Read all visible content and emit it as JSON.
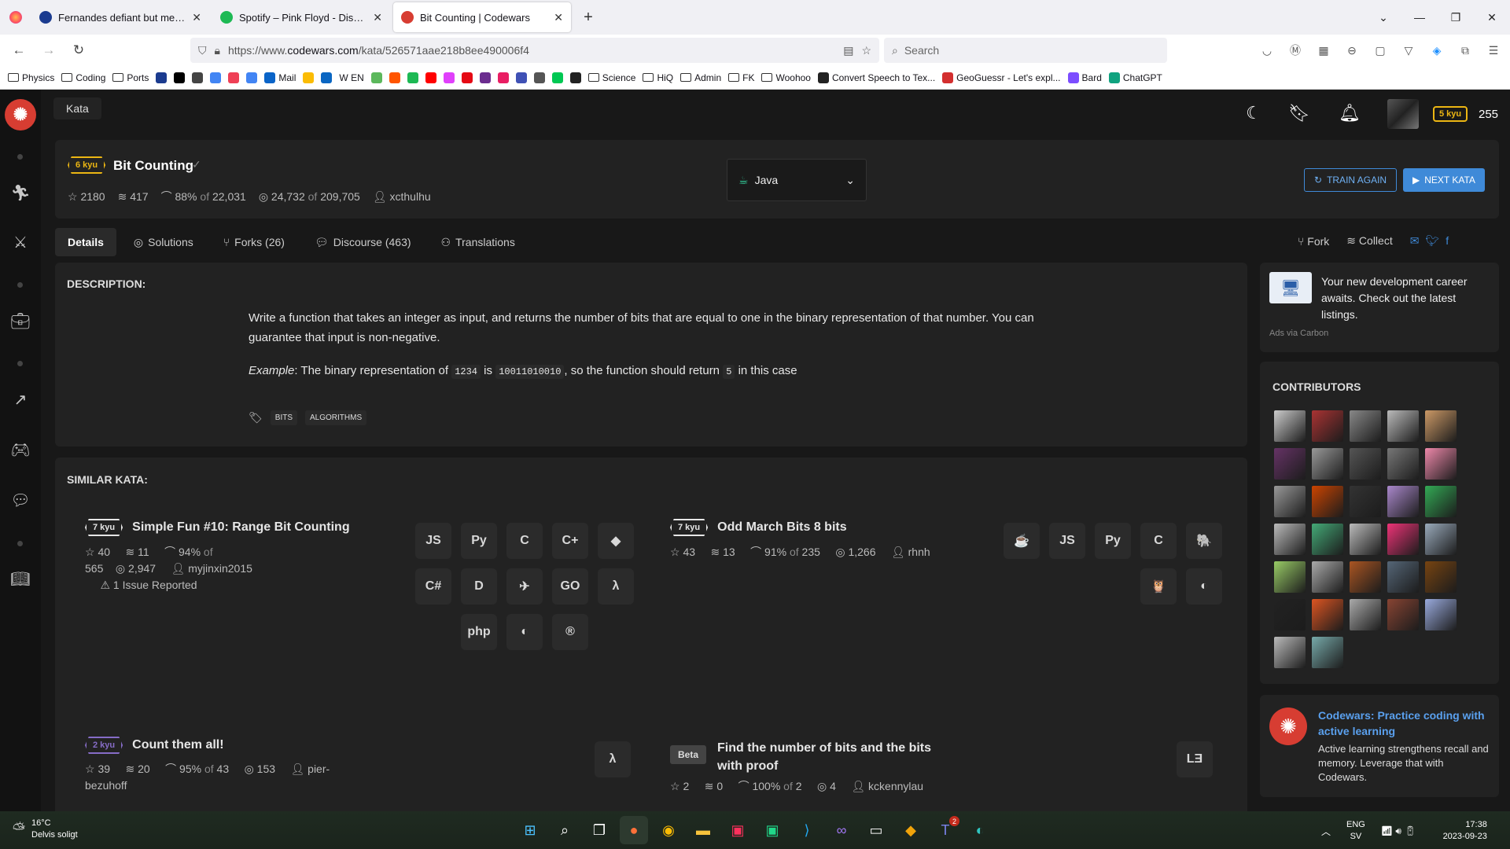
{
  "browser": {
    "tabs": [
      {
        "title": "Fernandes defiant but mess in M",
        "icon": "facebook-icon",
        "color": "#1b3b8f"
      },
      {
        "title": "Spotify – Pink Floyd - Discograp",
        "icon": "spotify-icon",
        "color": "#1db954"
      },
      {
        "title": "Bit Counting | Codewars",
        "icon": "codewars-icon",
        "color": "#d73d32"
      }
    ],
    "url_prefix": "https://www.",
    "url_host": "codewars.com",
    "url_path": "/kata/526571aae218b8ee490006f4",
    "search_placeholder": "Search",
    "bookmarks": [
      {
        "label": "Physics",
        "type": "folder"
      },
      {
        "label": "Coding",
        "type": "folder"
      },
      {
        "label": "Ports",
        "type": "folder"
      },
      {
        "label": "",
        "type": "icon",
        "color": "#1b3b8f"
      },
      {
        "label": "",
        "type": "icon",
        "color": "#000"
      },
      {
        "label": "",
        "type": "icon",
        "color": "#444"
      },
      {
        "label": "",
        "type": "icon",
        "color": "#4285f4"
      },
      {
        "label": "",
        "type": "icon",
        "color": "#ef4056"
      },
      {
        "label": "",
        "type": "icon",
        "color": "#4285f4"
      },
      {
        "label": "Mail",
        "type": "icon",
        "color": "#0a64c8"
      },
      {
        "label": "",
        "type": "icon",
        "color": "#fbbc04"
      },
      {
        "label": "",
        "type": "icon",
        "color": "#0a66c2"
      },
      {
        "label": "W EN",
        "type": "text"
      },
      {
        "label": "",
        "type": "icon",
        "color": "#5cb85c"
      },
      {
        "label": "",
        "type": "icon",
        "color": "#ff5500"
      },
      {
        "label": "",
        "type": "icon",
        "color": "#1db954"
      },
      {
        "label": "",
        "type": "icon",
        "color": "#ff0000"
      },
      {
        "label": "",
        "type": "icon",
        "color": "#e040fb"
      },
      {
        "label": "",
        "type": "icon",
        "color": "#e50914"
      },
      {
        "label": "",
        "type": "icon",
        "color": "#6b2d8f"
      },
      {
        "label": "",
        "type": "icon",
        "color": "#e91e63"
      },
      {
        "label": "",
        "type": "icon",
        "color": "#3f51b5"
      },
      {
        "label": "",
        "type": "icon",
        "color": "#555"
      },
      {
        "label": "",
        "type": "icon",
        "color": "#00c853"
      },
      {
        "label": "",
        "type": "icon",
        "color": "#222"
      },
      {
        "label": "Science",
        "type": "folder"
      },
      {
        "label": "HiQ",
        "type": "folder"
      },
      {
        "label": "Admin",
        "type": "folder"
      },
      {
        "label": "FK",
        "type": "folder"
      },
      {
        "label": "Woohoo",
        "type": "folder"
      },
      {
        "label": "Convert Speech to Tex...",
        "type": "icon",
        "color": "#222"
      },
      {
        "label": "GeoGuessr - Let's expl...",
        "type": "icon",
        "color": "#d32f2f"
      },
      {
        "label": "Bard",
        "type": "icon",
        "color": "#7c4dff"
      },
      {
        "label": "ChatGPT",
        "type": "icon",
        "color": "#10a37f"
      }
    ]
  },
  "codewars": {
    "crumb": "Kata",
    "rank": "5 kyu",
    "honor": "255",
    "kata": {
      "rank": "6 kyu",
      "title": "Bit Counting",
      "stars": "2180",
      "collections": "417",
      "satisfaction": "88%",
      "of_label": "of",
      "votes": "22,031",
      "completed": "24,732",
      "attempted": "209,705",
      "author": "xcthulhu"
    },
    "language": "Java",
    "train_again": "TRAIN AGAIN",
    "next_kata": "NEXT KATA",
    "tabs": [
      "Details",
      "Solutions",
      "Forks (26)",
      "Discourse (463)",
      "Translations"
    ],
    "actions": {
      "fork": "Fork",
      "collect": "Collect"
    },
    "description_header": "DESCRIPTION:",
    "description_p1": "Write a function that takes an integer as input, and returns the number of bits that are equal to one in the binary representation of that number. You can guarantee that input is non-negative.",
    "example": {
      "em": "Example",
      "t1": ": The binary representation of ",
      "c1": "1234",
      "t2": " is ",
      "c2": "10011010010",
      "t3": ", so the function should return ",
      "c3": "5",
      "t4": " in this case"
    },
    "tags": [
      "BITS",
      "ALGORITHMS"
    ],
    "similar_header": "SIMILAR KATA:",
    "similar": [
      {
        "rank": "7 kyu",
        "title": "Simple Fun #10: Range Bit Counting",
        "stars": "40",
        "coll": "11",
        "pct": "94%",
        "of": "of",
        "votes": "565",
        "completed": "2,947",
        "author": "myjinxin2015",
        "issue": "1 Issue Reported"
      },
      {
        "rank": "7 kyu",
        "title": "Odd March Bits 8 bits",
        "stars": "43",
        "coll": "13",
        "pct": "91%",
        "of": "of",
        "votes": "235",
        "completed": "1,266",
        "author": "rhnh"
      },
      {
        "rank": "2 kyu",
        "title": "Count them all!",
        "stars": "39",
        "coll": "20",
        "pct": "95%",
        "of": "of",
        "votes": "43",
        "completed": "153",
        "author": "pier-bezuhoff"
      },
      {
        "rank": "Beta",
        "title": "Find the number of bits and the bits with proof",
        "stars": "2",
        "coll": "0",
        "pct": "100%",
        "of": "of",
        "votes": "2",
        "completed": "4",
        "author": "kckennylau"
      }
    ],
    "langs1": [
      "JS",
      "Py",
      "C",
      "C+",
      "◆",
      "C#",
      "D",
      "✈",
      "GO",
      "λ",
      "php",
      "◐",
      "®"
    ],
    "langs2": [
      "☕",
      "JS",
      "Py",
      "C",
      "🐘",
      "🦉",
      "◐"
    ],
    "langs3": [
      "λ"
    ],
    "langs4": [
      "LƎ"
    ],
    "ad": {
      "text": "Your new development career awaits. Check out the latest listings.",
      "via": "Ads via Carbon"
    },
    "contributors_header": "CONTRIBUTORS",
    "contributors": [
      "#ccc",
      "#a33",
      "#888",
      "#bbb",
      "#c96",
      "#636",
      "#999",
      "#555",
      "#777",
      "#e8a",
      "#999",
      "#c40",
      "#333",
      "#a8c",
      "#3a5",
      "#bbb",
      "#4a7",
      "#bbb",
      "#e37",
      "#9ab",
      "#9c6",
      "#aaa",
      "#a52",
      "#567",
      "#741",
      "#222",
      "#d52",
      "#aaa",
      "#843",
      "#9ad",
      "#bbb",
      "#7aa"
    ],
    "promo": {
      "title": "Codewars: Practice coding with active learning",
      "text": "Active learning strengthens recall and memory. Leverage that with Codewars."
    }
  },
  "taskbar": {
    "temp": "16°C",
    "weather": "Delvis soligt",
    "lang1": "ENG",
    "lang2": "SV",
    "time": "17:38",
    "date": "2023-09-23",
    "teams_badge": "2"
  }
}
